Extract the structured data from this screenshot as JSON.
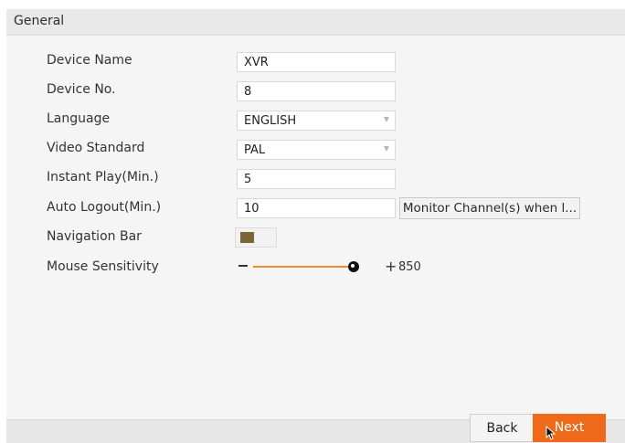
{
  "header": {
    "title": "General"
  },
  "form": {
    "device_name": {
      "label": "Device Name",
      "value": "XVR"
    },
    "device_no": {
      "label": "Device No.",
      "value": "8"
    },
    "language": {
      "label": "Language",
      "value": "ENGLISH"
    },
    "video_standard": {
      "label": "Video Standard",
      "value": "PAL"
    },
    "instant_play": {
      "label": "Instant Play(Min.)",
      "value": "5"
    },
    "auto_logout": {
      "label": "Auto Logout(Min.)",
      "value": "10",
      "button_label": "Monitor Channel(s) when l..."
    },
    "navigation_bar": {
      "label": "Navigation Bar",
      "enabled": true
    },
    "mouse_sensitivity": {
      "label": "Mouse Sensitivity",
      "minus": "−",
      "plus": "+",
      "value": "850",
      "level_fraction": 0.95
    }
  },
  "footer": {
    "back_label": "Back",
    "next_label": "Next"
  },
  "colors": {
    "accent": "#ee6a1a",
    "slider_track": "#f08a2a",
    "toggle_on": "#7d6436"
  },
  "icons": {
    "dropdown": "dropdown-arrow-icon",
    "cursor": "mouse-pointer-icon"
  }
}
